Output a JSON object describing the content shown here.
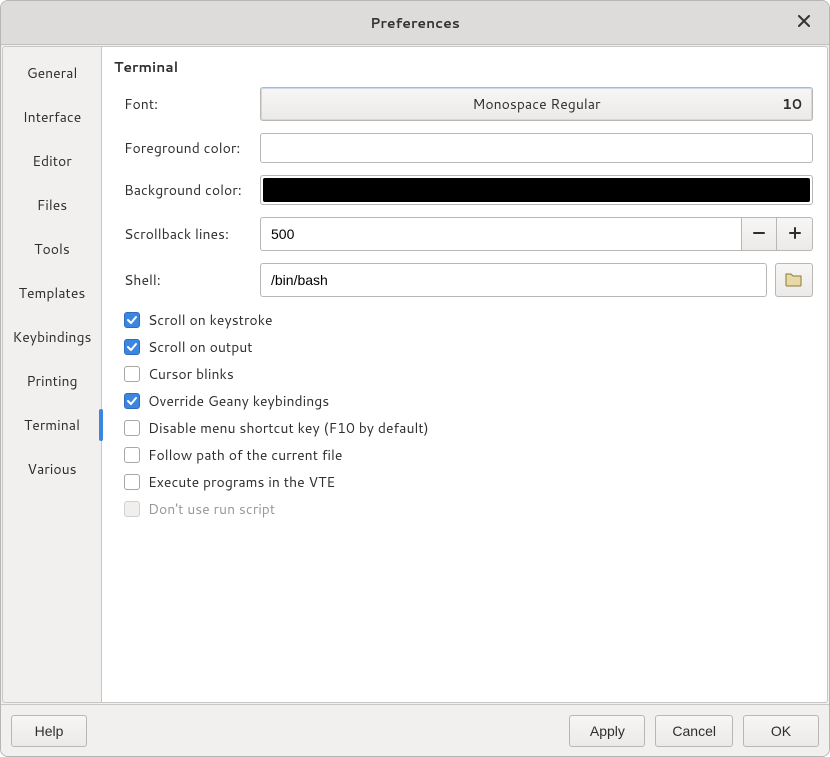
{
  "window": {
    "title": "Preferences"
  },
  "sidebar": {
    "tabs": [
      {
        "label": "General"
      },
      {
        "label": "Interface"
      },
      {
        "label": "Editor"
      },
      {
        "label": "Files"
      },
      {
        "label": "Tools"
      },
      {
        "label": "Templates"
      },
      {
        "label": "Keybindings"
      },
      {
        "label": "Printing"
      },
      {
        "label": "Terminal"
      },
      {
        "label": "Various"
      }
    ],
    "active_index": 8
  },
  "section": {
    "title": "Terminal",
    "labels": {
      "font": "Font:",
      "fg": "Foreground color:",
      "bg": "Background color:",
      "scrollback": "Scrollback lines:",
      "shell": "Shell:"
    },
    "font": {
      "name": "Monospace Regular",
      "size": "10"
    },
    "fg_color": "#ffffff",
    "bg_color": "#000000",
    "scrollback": "500",
    "shell": "/bin/bash",
    "checks": {
      "scroll_keystroke": {
        "label": "Scroll on keystroke",
        "checked": true
      },
      "scroll_output": {
        "label": "Scroll on output",
        "checked": true
      },
      "cursor_blinks": {
        "label": "Cursor blinks",
        "checked": false
      },
      "override_kb": {
        "label": "Override Geany keybindings",
        "checked": true
      },
      "disable_menu": {
        "label": "Disable menu shortcut key (F10 by default)",
        "checked": false
      },
      "follow_path": {
        "label": "Follow path of the current file",
        "checked": false
      },
      "exec_vte": {
        "label": "Execute programs in the VTE",
        "checked": false
      },
      "no_run_script": {
        "label": "Don't use run script",
        "checked": false,
        "disabled": true
      }
    }
  },
  "footer": {
    "help": "Help",
    "apply": "Apply",
    "cancel": "Cancel",
    "ok": "OK"
  }
}
